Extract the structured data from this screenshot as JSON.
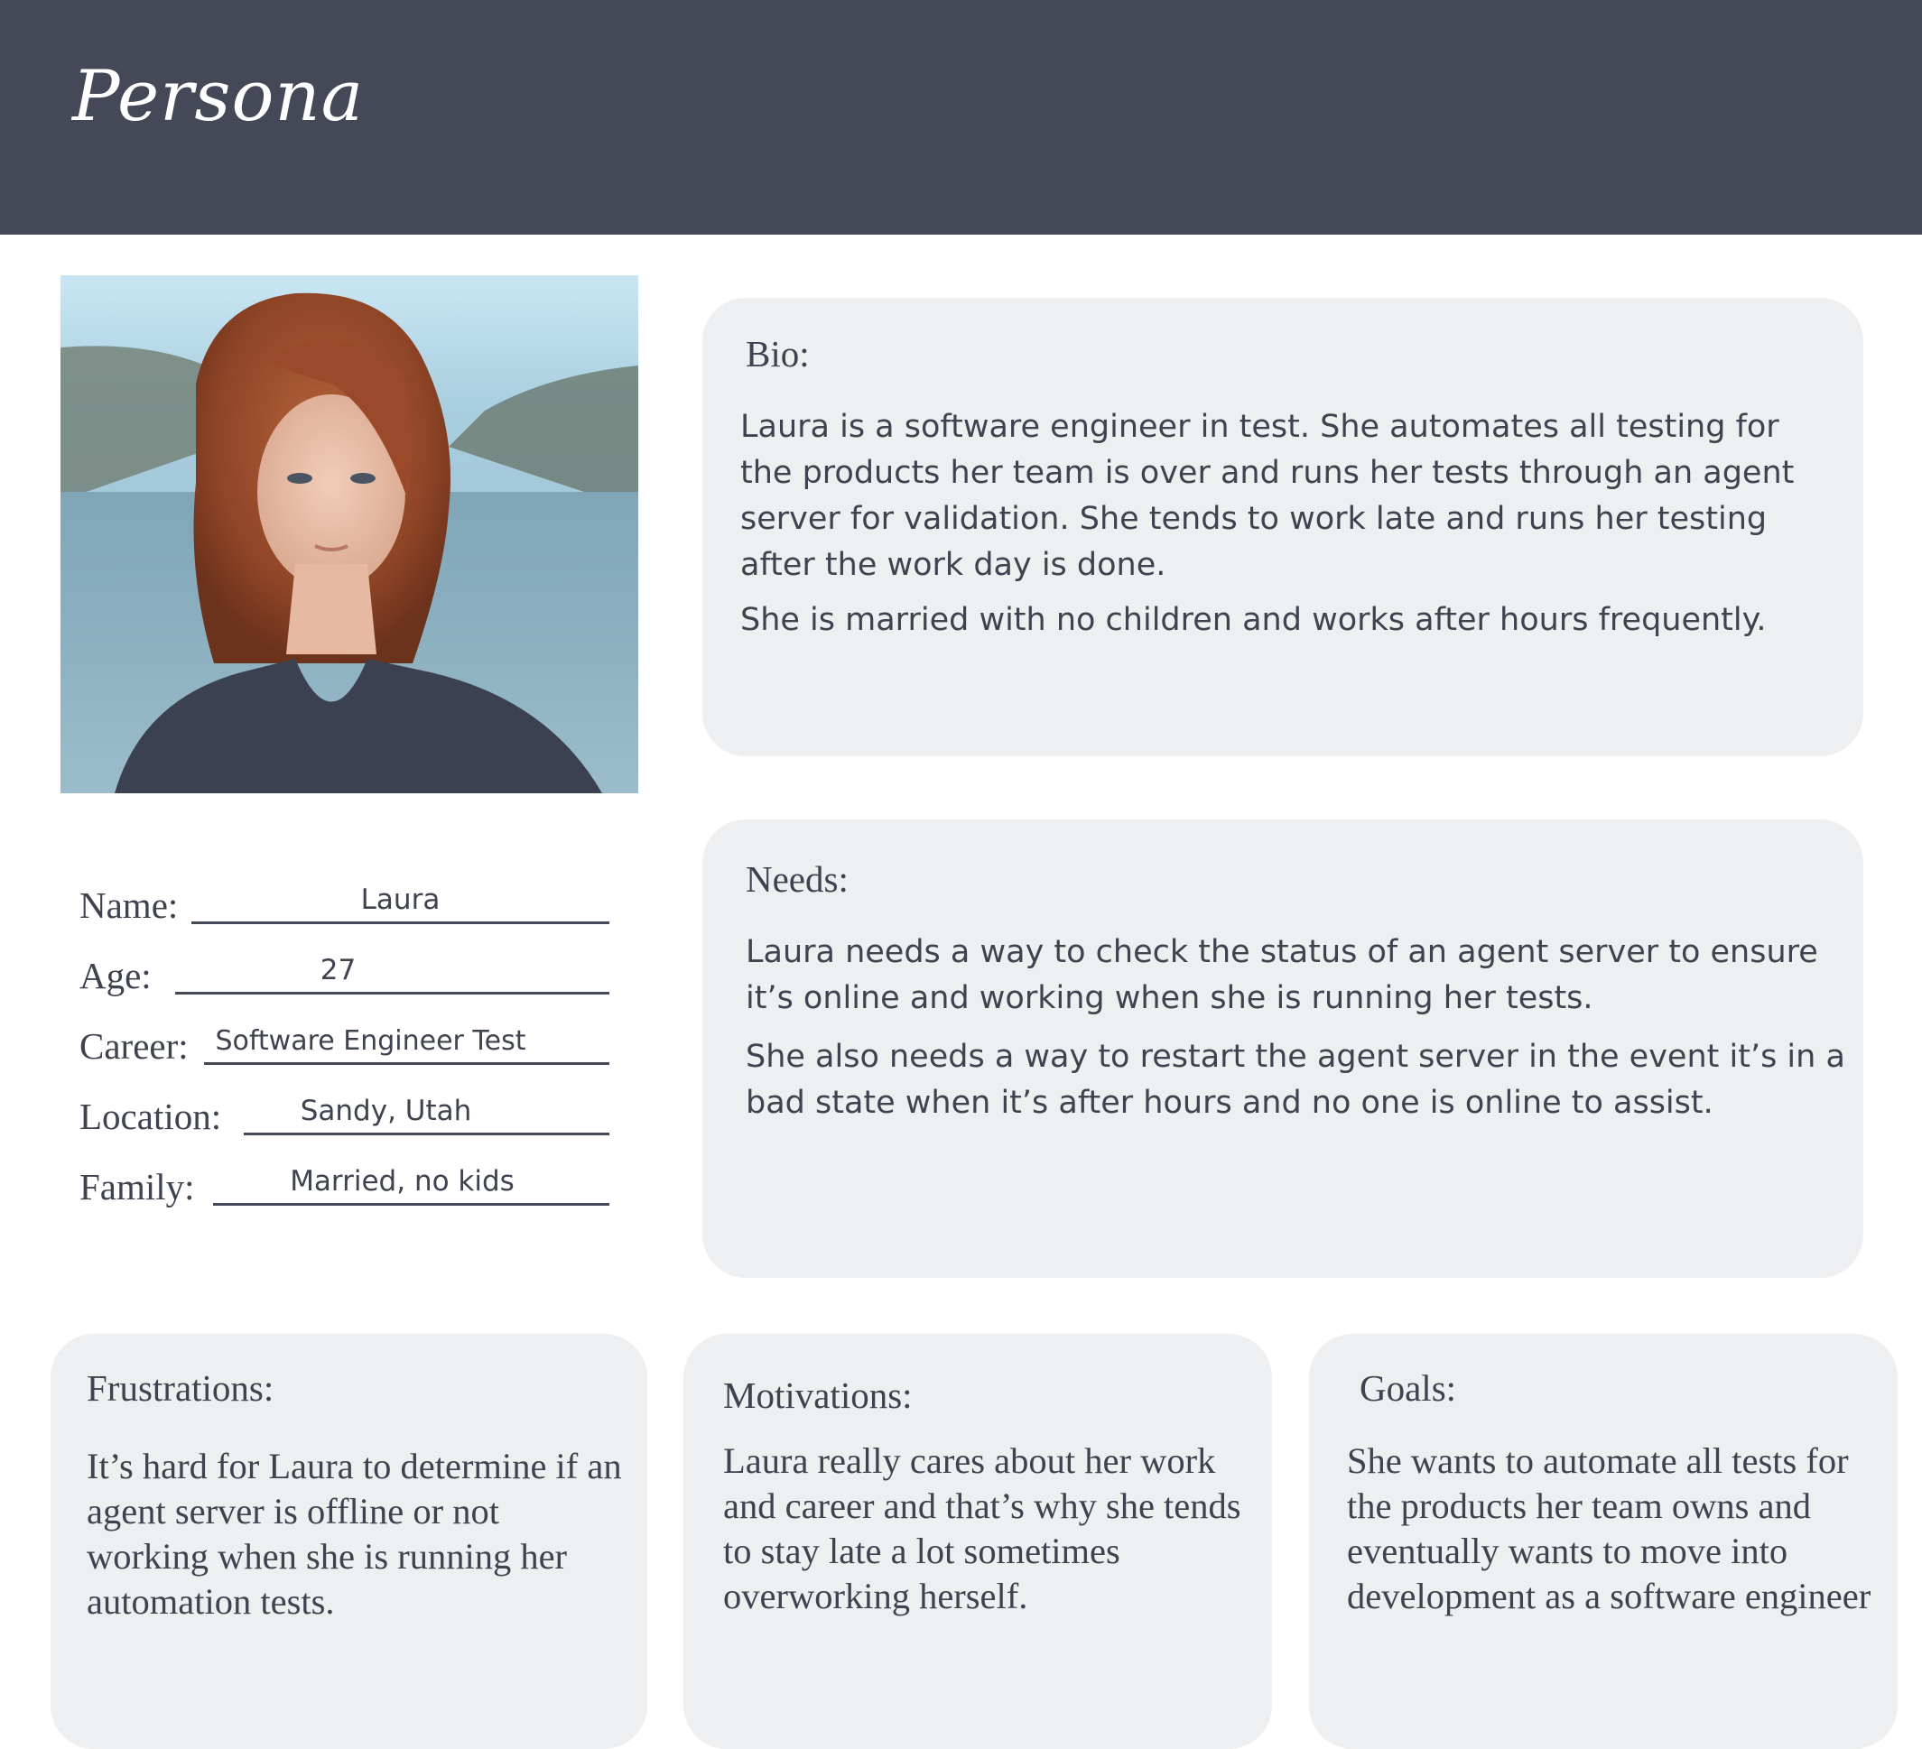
{
  "header": {
    "title": "Persona"
  },
  "profile": {
    "photo_alt": "Portrait photo",
    "fields": [
      {
        "label": "Name:",
        "value": "Laura"
      },
      {
        "label": "Age:",
        "value": "27"
      },
      {
        "label": "Career:",
        "value": "Software Engineer Test"
      },
      {
        "label": "Location:",
        "value": "Sandy, Utah"
      },
      {
        "label": "Family:",
        "value": "Married, no kids"
      }
    ]
  },
  "bio": {
    "title": "Bio:",
    "paragraphs": [
      "Laura is a software engineer in test. She automates all testing for the products her team is over and runs her tests through an agent server for validation. She tends to work late and runs her testing after the work day is done.",
      "She is married with no children and works after hours frequently."
    ]
  },
  "needs": {
    "title": "Needs:",
    "paragraphs": [
      "Laura needs a way to check the status of an agent server to ensure it’s online and working when she is running her tests.",
      "She also needs a way to restart the agent server in the event it’s in a bad state when it’s after hours and no one is online to assist."
    ]
  },
  "frustrations": {
    "title": "Frustrations:",
    "text": "It’s hard for Laura to determine if an agent server is offline or not working when she is running her automation tests."
  },
  "motivations": {
    "title": "Motivations:",
    "text": "Laura really cares about her work and career and that’s why she tends to stay late a lot sometimes overworking herself."
  },
  "goals": {
    "title": "Goals:",
    "text": "She wants to automate all tests for the products her team owns and eventually wants to move into development as a software engineer"
  }
}
